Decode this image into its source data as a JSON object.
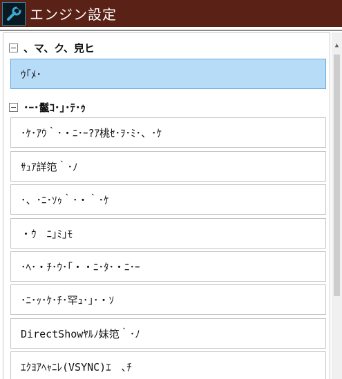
{
  "window": {
    "title": "エンジン設定",
    "icon": "wrench-icon"
  },
  "groups": [
    {
      "label": "、マ、ク、皃ヒ",
      "items": [
        {
          "label": "ｳ｢ﾒ･",
          "selected": true
        }
      ]
    },
    {
      "label": "･ｰ･鬣ｺ･｣･ﾃ･ｩ",
      "items": [
        {
          "label": "･ｹ･ｱｳ｀･・ﾆ･ｰ?ｱ桃ｾ･ｦ･ﾐ･、･ｹ"
        },
        {
          "label": "ｻｭｱ詳笵｀･ﾉ"
        },
        {
          "label": "･、･ﾆ･ｿｩ｀･・｀･ｹ"
        },
        {
          "label": "・ｳ　ﾆ｣ﾐ｣ﾓ"
        },
        {
          "label": "･ﾍ･・ﾁ･ｳ･｢・・ﾆ･ﾀ･・ﾆ･ｰ"
        },
        {
          "label": "･ﾆ･ｯ･ｹ･ﾁ･罕ｭ･｣･・ｿ"
        },
        {
          "label": "DirectShowﾔﾙﾉ妹笵｀･ﾉ"
        },
        {
          "label": "ｴｸﾖｱﾍｬﾆﾚ(VSYNC)ｴ　､ﾁ"
        }
      ]
    }
  ],
  "colors": {
    "titlebar": "#5a2116",
    "selection": "#b7dcf8",
    "selection_border": "#64a8e0"
  }
}
